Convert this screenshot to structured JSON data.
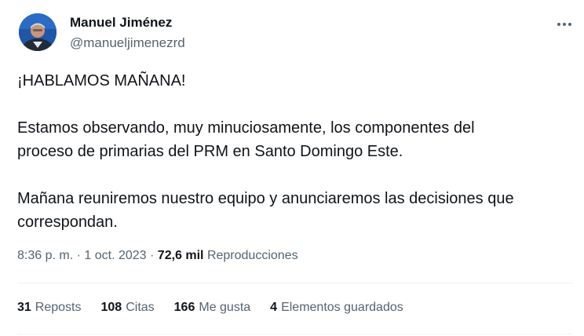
{
  "author": {
    "display_name": "Manuel Jiménez",
    "handle": "@manueljimenezrd"
  },
  "tweet": {
    "lines": [
      "¡HABLAMOS MAÑANA!",
      "Estamos observando, muy minuciosamente, los componentes del",
      "proceso de primarias del PRM en Santo Domingo Este.",
      "Mañana reuniremos nuestro equipo y anunciaremos las decisiones que",
      "correspondan."
    ]
  },
  "meta": {
    "time": "8:36 p. m.",
    "separator": "·",
    "date": "1 oct. 2023",
    "views_count": "72,6 mil",
    "views_label": "Reproducciones"
  },
  "stats": [
    {
      "count": "31",
      "label": "Reposts"
    },
    {
      "count": "108",
      "label": "Citas"
    },
    {
      "count": "166",
      "label": "Me gusta"
    },
    {
      "count": "4",
      "label": "Elementos guardados"
    }
  ],
  "icons": {
    "more": "more-horizontal-icon"
  },
  "colors": {
    "text_primary": "#0f1419",
    "text_secondary": "#536471",
    "divider": "#eff3f4"
  }
}
